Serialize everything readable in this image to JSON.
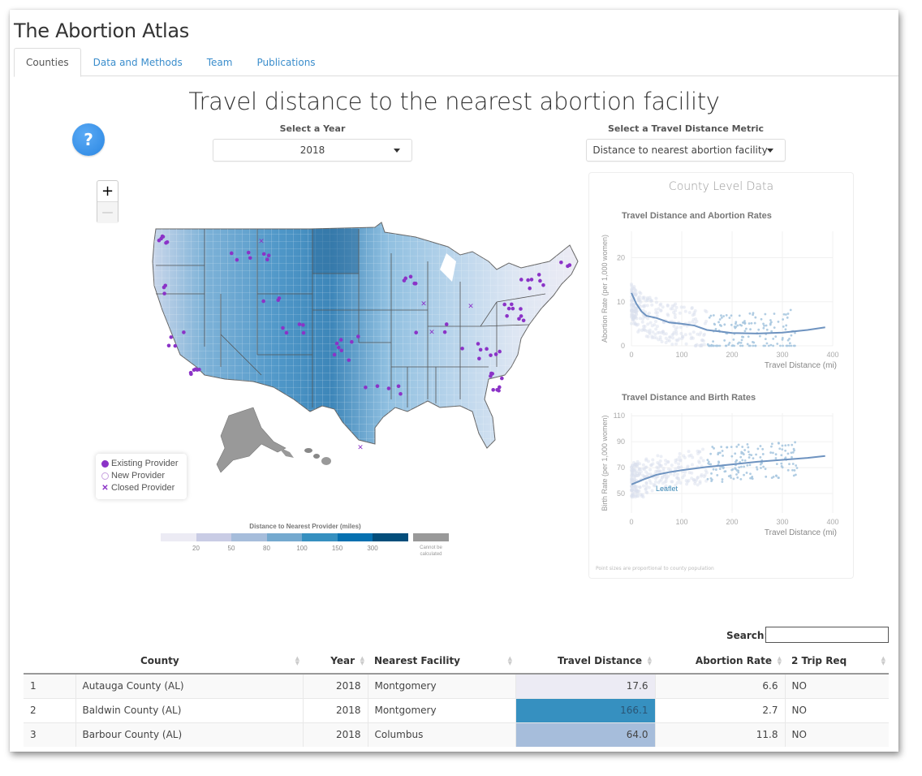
{
  "app": {
    "title": "The Abortion Atlas"
  },
  "tabs": [
    {
      "label": "Counties",
      "active": true
    },
    {
      "label": "Data and Methods",
      "active": false
    },
    {
      "label": "Team",
      "active": false
    },
    {
      "label": "Publications",
      "active": false
    }
  ],
  "page_title": "Travel distance to the nearest abortion facility",
  "help_button": {
    "icon": "question-icon",
    "label": "?"
  },
  "year_select": {
    "label": "Select a Year",
    "value": "2018"
  },
  "metric_select": {
    "label": "Select a Travel Distance Metric",
    "value": "Distance to nearest abortion facility"
  },
  "map": {
    "zoom_in": "+",
    "zoom_out": "—",
    "legend": [
      {
        "symbol": "filled-circle",
        "label": "Existing Provider"
      },
      {
        "symbol": "open-circle",
        "label": "New Provider"
      },
      {
        "symbol": "x",
        "label": "Closed Provider"
      }
    ],
    "marker_color": "#8b33c7",
    "na_region_color": "#999999",
    "scale": {
      "title": "Distance to Nearest Provider (miles)",
      "colors": [
        "#ecebf4",
        "#c9cce5",
        "#a6bddb",
        "#74a9cf",
        "#3690c0",
        "#0570b0",
        "#034e7b"
      ],
      "breaks": [
        "20",
        "50",
        "80",
        "100",
        "150",
        "300"
      ],
      "na_label": "Cannot be calculated",
      "na_color": "#999999"
    },
    "attribution": "Leaflet"
  },
  "side_panel": {
    "title": "County Level Data",
    "footnote": "Point sizes are proportional to county population"
  },
  "chart_data": [
    {
      "type": "scatter",
      "title": "Travel Distance and Abortion Rates",
      "xlabel": "Travel Distance (mi)",
      "ylabel": "Abortion Rate (per 1,000 women)",
      "xlim": [
        0,
        400
      ],
      "ylim": [
        0,
        26
      ],
      "xticks": [
        "0",
        "100",
        "200",
        "300",
        "400"
      ],
      "yticks": [
        "0",
        "10",
        "20"
      ],
      "ytick_values": [
        0,
        10,
        20
      ],
      "grid": true,
      "trend": {
        "x": [
          0,
          10,
          20,
          30,
          50,
          75,
          100,
          125,
          150,
          200,
          250,
          300,
          350,
          385
        ],
        "y": [
          12.0,
          9.5,
          7.8,
          6.8,
          6.3,
          5.3,
          5.0,
          4.6,
          3.6,
          2.9,
          2.8,
          3.0,
          3.6,
          4.2
        ]
      },
      "point_color": "#a8c8e0"
    },
    {
      "type": "scatter",
      "title": "Travel Distance and Birth Rates",
      "xlabel": "Travel Distance (mi)",
      "ylabel": "Birth Rate (per 1,000 women)",
      "xlim": [
        0,
        400
      ],
      "ylim": [
        35,
        112
      ],
      "xticks": [
        "0",
        "100",
        "200",
        "300",
        "400"
      ],
      "yticks": [
        "50",
        "70",
        "90",
        "110"
      ],
      "ytick_values": [
        50,
        70,
        90,
        110
      ],
      "grid": true,
      "trend": {
        "x": [
          0,
          25,
          50,
          75,
          100,
          150,
          200,
          250,
          300,
          350,
          385
        ],
        "y": [
          57,
          61,
          64.5,
          66.5,
          68,
          70.5,
          72.5,
          74.5,
          76,
          77.5,
          79
        ]
      },
      "point_color": "#a8c8e0"
    }
  ],
  "table": {
    "search_label": "Search:",
    "search_value": "",
    "columns": [
      "",
      "County",
      "Year",
      "Nearest Facility",
      "Travel Distance",
      "Abortion Rate",
      "2 Trip Req"
    ],
    "rows": [
      {
        "index": "1",
        "county": "Autauga County (AL)",
        "year": "2018",
        "facility": "Montgomery",
        "distance": "17.6",
        "distance_color": "#ecebf4",
        "rate": "6.6",
        "two_trip": "NO"
      },
      {
        "index": "2",
        "county": "Baldwin County (AL)",
        "year": "2018",
        "facility": "Montgomery",
        "distance": "166.1",
        "distance_color": "#3690c0",
        "rate": "2.7",
        "two_trip": "NO"
      },
      {
        "index": "3",
        "county": "Barbour County (AL)",
        "year": "2018",
        "facility": "Columbus",
        "distance": "64.0",
        "distance_color": "#a6bddb",
        "rate": "11.8",
        "two_trip": "NO"
      }
    ]
  }
}
